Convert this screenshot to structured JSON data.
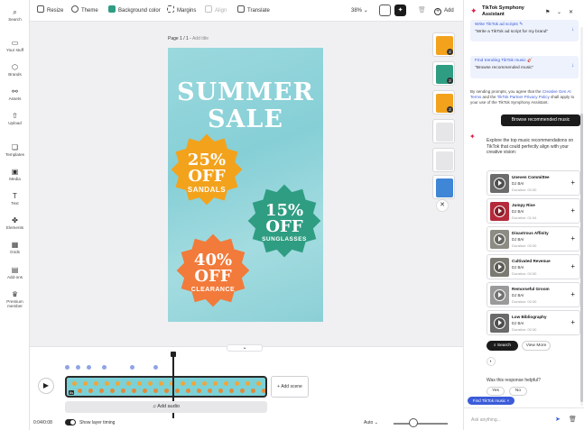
{
  "rail": [
    {
      "key": "search",
      "label": "Search",
      "icon": "search-icon",
      "glyph": "⌕"
    },
    {
      "key": "your_stuff",
      "label": "Your stuff",
      "icon": "folder-icon",
      "glyph": "▭"
    },
    {
      "key": "brands",
      "label": "Brands",
      "icon": "brand-icon",
      "glyph": "⬡"
    },
    {
      "key": "assets",
      "label": "Assets",
      "icon": "assets-icon",
      "glyph": "⚯"
    },
    {
      "key": "upload",
      "label": "Upload",
      "icon": "upload-icon",
      "glyph": "⇧"
    },
    {
      "key": "templates",
      "label": "Templates",
      "icon": "templates-icon",
      "glyph": "❏"
    },
    {
      "key": "media",
      "label": "Media",
      "icon": "media-icon",
      "glyph": "▣"
    },
    {
      "key": "text",
      "label": "Text",
      "icon": "text-icon",
      "glyph": "T"
    },
    {
      "key": "elements",
      "label": "Elements",
      "icon": "elements-icon",
      "glyph": "✤"
    },
    {
      "key": "grids",
      "label": "Grids",
      "icon": "grids-icon",
      "glyph": "▦"
    },
    {
      "key": "add_ons",
      "label": "Add-ons",
      "icon": "addons-icon",
      "glyph": "▤"
    },
    {
      "key": "premium",
      "label": "Premium member",
      "icon": "crown-icon",
      "glyph": "♛"
    }
  ],
  "toolbar": {
    "resize": "Resize",
    "theme": "Theme",
    "background_color": "Background color",
    "margins": "Margins",
    "align": "Align",
    "translate": "Translate",
    "zoom": "38%",
    "add": "Add"
  },
  "canvas": {
    "page_label": "Page 1 / 1 - ",
    "add_title": "Add title"
  },
  "poster": {
    "title_line1": "SUMMER",
    "title_line2": "SALE",
    "badges": [
      {
        "pct": "25%",
        "off": "OFF",
        "item": "SANDALS",
        "color": "#f3a21c"
      },
      {
        "pct": "15%",
        "off": "OFF",
        "item": "SUNGLASSES",
        "color": "#2f9d82"
      },
      {
        "pct": "40%",
        "off": "OFF",
        "item": "CLEARANCE",
        "color": "#f27a3a"
      }
    ]
  },
  "thumbs": [
    {
      "count": "2"
    },
    {
      "count": "2"
    },
    {
      "count": "2"
    },
    {
      "count": ""
    },
    {
      "count": ""
    },
    {
      "count": ""
    }
  ],
  "timeline": {
    "add_scene": "+ Add scene",
    "add_audio": "Add audio",
    "time": "0:04/0:08",
    "show_layer_timing": "Show layer timing",
    "zoom_mode": "Auto",
    "track_label": "8s"
  },
  "assistant": {
    "title": "TikTok Symphony Assistant",
    "suggestions": [
      {
        "title": "Write TikTok ad scripts ✎",
        "subtitle": "\"Write a TikTok ad script for my brand\""
      },
      {
        "title": "Find trending TikTok music 🎸",
        "subtitle": "\"Browse recommended music\""
      }
    ],
    "disclaimer_pre": "By sending prompts, you agree that the ",
    "disclaimer_link1": "Creative Gen AI Terms",
    "disclaimer_mid": " and the ",
    "disclaimer_link2": "TikTok Partner Privacy Policy",
    "disclaimer_post": " shall apply to your use of the TikTok Symphony Assistant.",
    "user_message": "Browse recommended music",
    "bot_message": "Explore the top music recommendations on TikTok that could perfectly align with your creative vision:",
    "tracks": [
      {
        "name": "Uneven Committee",
        "artist": "DJ BAI",
        "duration": "Duration: 00:30",
        "art": "#6b6b6b"
      },
      {
        "name": "Jumpy Rise",
        "artist": "DJ BAI",
        "duration": "Duration: 01:04",
        "art": "#b52a3a"
      },
      {
        "name": "Disastrous Affinity",
        "artist": "DJ BAI",
        "duration": "Duration: 00:30",
        "art": "#8c8c84"
      },
      {
        "name": "Cultivated Revenue",
        "artist": "DJ BAI",
        "duration": "Duration: 00:30",
        "art": "#7a7a72"
      },
      {
        "name": "Remorseful Groom",
        "artist": "DJ BAI",
        "duration": "Duration: 00:30",
        "art": "#9a9a9a"
      },
      {
        "name": "Low Bibliography",
        "artist": "DJ BAI",
        "duration": "Duration: 00:30",
        "art": "#6a6a6a"
      }
    ],
    "search": "Search",
    "view_more": "View More",
    "helpful_q": "Was this response helpful?",
    "yes": "Yes",
    "no": "No",
    "chip": "Find TikTok music ×",
    "input_placeholder": "Ask anything..."
  }
}
